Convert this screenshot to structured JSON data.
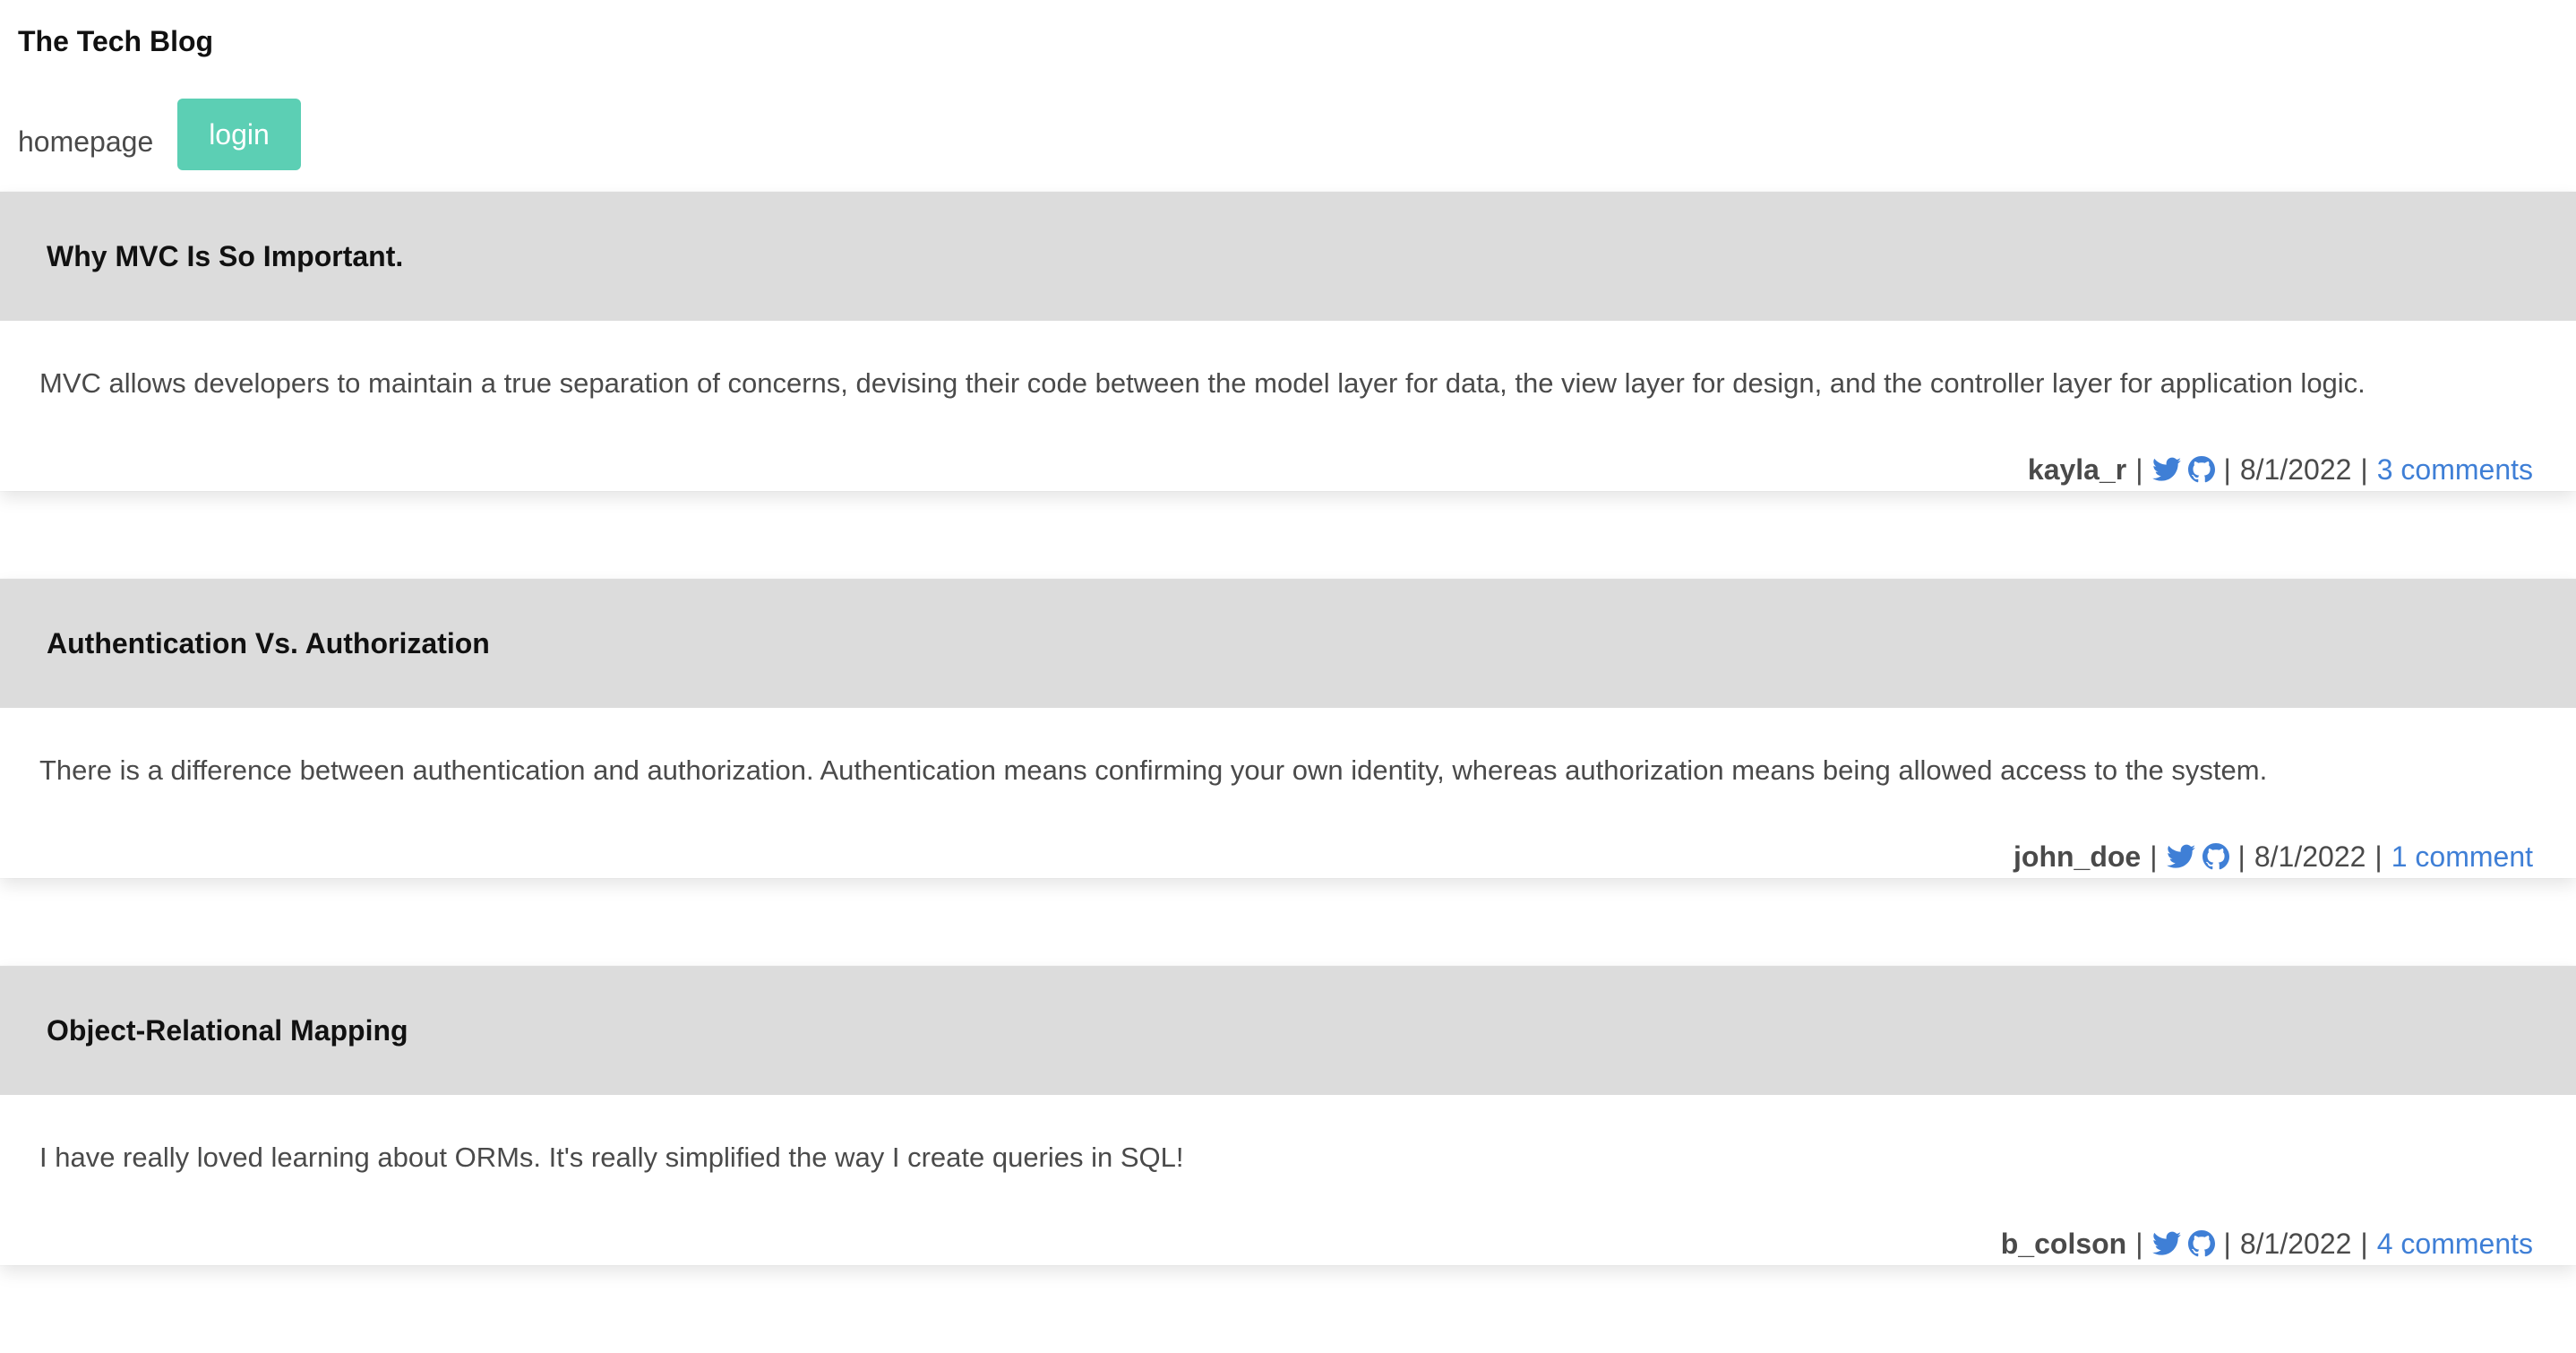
{
  "site": {
    "title": "The Tech Blog"
  },
  "nav": {
    "home_label": "homepage",
    "login_label": "login"
  },
  "colors": {
    "accent": "#5ccfb4",
    "link": "#3f7fd6",
    "post_header_bg": "#dcdcdc"
  },
  "posts": [
    {
      "title": "Why MVC Is So Important.",
      "content": "MVC allows developers to maintain a true separation of concerns, devising their code between the model layer for data, the view layer for design, and the controller layer for application logic.",
      "author": "kayla_r",
      "date": "8/1/2022",
      "comments_label": "3 comments",
      "icons": [
        "twitter-icon",
        "github-icon"
      ]
    },
    {
      "title": "Authentication Vs. Authorization",
      "content": "There is a difference between authentication and authorization. Authentication means confirming your own identity, whereas authorization means being allowed access to the system.",
      "author": "john_doe",
      "date": "8/1/2022",
      "comments_label": "1 comment",
      "icons": [
        "twitter-icon",
        "github-icon"
      ]
    },
    {
      "title": "Object-Relational Mapping",
      "content": "I have really loved learning about ORMs. It's really simplified the way I create queries in SQL!",
      "author": "b_colson",
      "date": "8/1/2022",
      "comments_label": "4 comments",
      "icons": [
        "twitter-icon",
        "github-icon"
      ]
    }
  ],
  "separator": "|"
}
